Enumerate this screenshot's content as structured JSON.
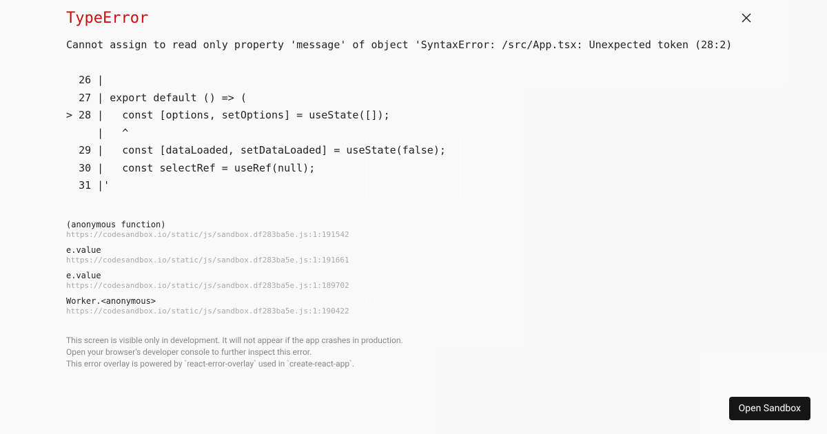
{
  "background": {
    "status": "Transpiling Modules..."
  },
  "error": {
    "title": "TypeError",
    "message": "Cannot assign to read only property 'message' of object 'SyntaxError: /src/App.tsx: Unexpected token (28:2)\n\n  26 |\n  27 | export default () => (\n> 28 |   const [options, setOptions] = useState([]);\n     |   ^\n  29 |   const [dataLoaded, setDataLoaded] = useState(false);\n  30 |   const selectRef = useRef(null);\n  31 |'"
  },
  "stack": [
    {
      "fn": "(anonymous function)",
      "loc": "https://codesandbox.io/static/js/sandbox.df283ba5e.js:1:191542"
    },
    {
      "fn": "e.value",
      "loc": "https://codesandbox.io/static/js/sandbox.df283ba5e.js:1:191661"
    },
    {
      "fn": "e.value",
      "loc": "https://codesandbox.io/static/js/sandbox.df283ba5e.js:1:189702"
    },
    {
      "fn": "Worker.<anonymous>",
      "loc": "https://codesandbox.io/static/js/sandbox.df283ba5e.js:1:190422"
    }
  ],
  "footer": {
    "line1": "This screen is visible only in development. It will not appear if the app crashes in production.",
    "line2": "Open your browser's developer console to further inspect this error.",
    "line3": "This error overlay is powered by `react-error-overlay` used in `create-react-app`."
  },
  "buttons": {
    "open_sandbox": "Open Sandbox"
  }
}
